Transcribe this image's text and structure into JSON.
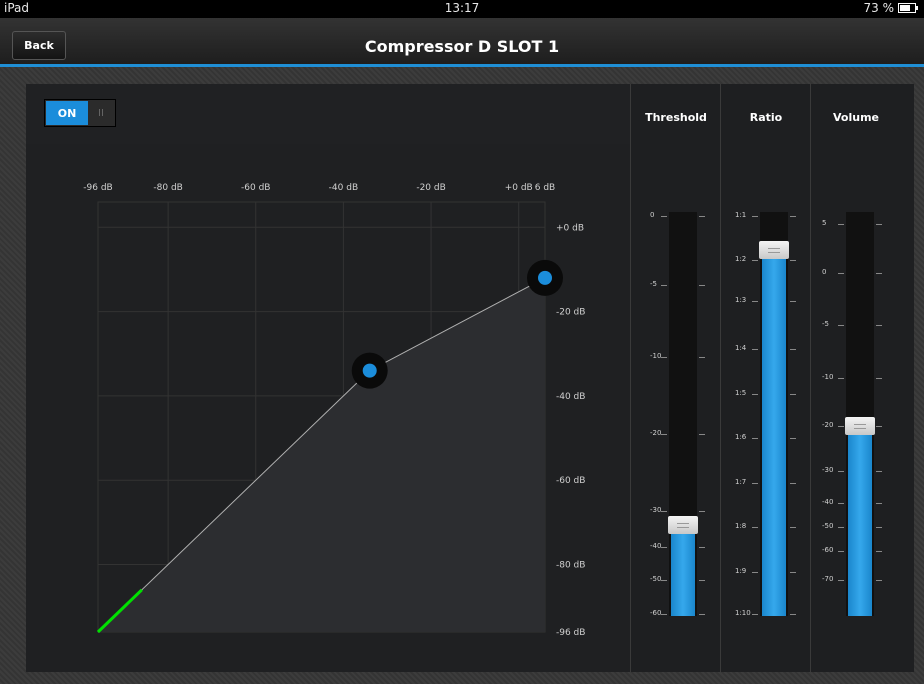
{
  "status_bar": {
    "device": "iPad",
    "time": "13:17",
    "battery": "73 %"
  },
  "nav": {
    "back_label": "Back",
    "title": "Compressor D SLOT 1"
  },
  "switch": {
    "on_label": "ON",
    "off_glyph": "II",
    "state": "on"
  },
  "graph": {
    "x_axis_labels": [
      "-96 dB",
      "-80 dB",
      "-60 dB",
      "-40 dB",
      "-20 dB",
      "+0 dB",
      "6 dB"
    ],
    "y_axis_labels": [
      "+0 dB",
      "-20 dB",
      "-40 dB",
      "-60 dB",
      "-80 dB",
      "-96 dB"
    ],
    "curve_points_db": [
      {
        "input": -96,
        "output": -96
      },
      {
        "input": -34,
        "output": -34
      },
      {
        "input": 6,
        "output": -12
      }
    ],
    "level_meter_db": {
      "from": -96,
      "to": -86
    },
    "accent_color": "#1b8ddb",
    "meter_color": "#00e000"
  },
  "faders": {
    "threshold": {
      "title": "Threshold",
      "scale": [
        "0",
        "-5",
        "-10",
        "-20",
        "-30",
        "-40",
        "-50",
        "-60"
      ],
      "value": "-32"
    },
    "ratio": {
      "title": "Ratio",
      "scale": [
        "1:1",
        "1:2",
        "1:3",
        "1:4",
        "1:5",
        "1:6",
        "1:7",
        "1:8",
        "1:9",
        "1:10"
      ],
      "value": "1:2"
    },
    "volume": {
      "title": "Volume",
      "scale": [
        "5",
        "0",
        "-5",
        "-10",
        "-20",
        "-30",
        "-40",
        "-50",
        "-60",
        "-70"
      ],
      "value": "-21"
    }
  }
}
